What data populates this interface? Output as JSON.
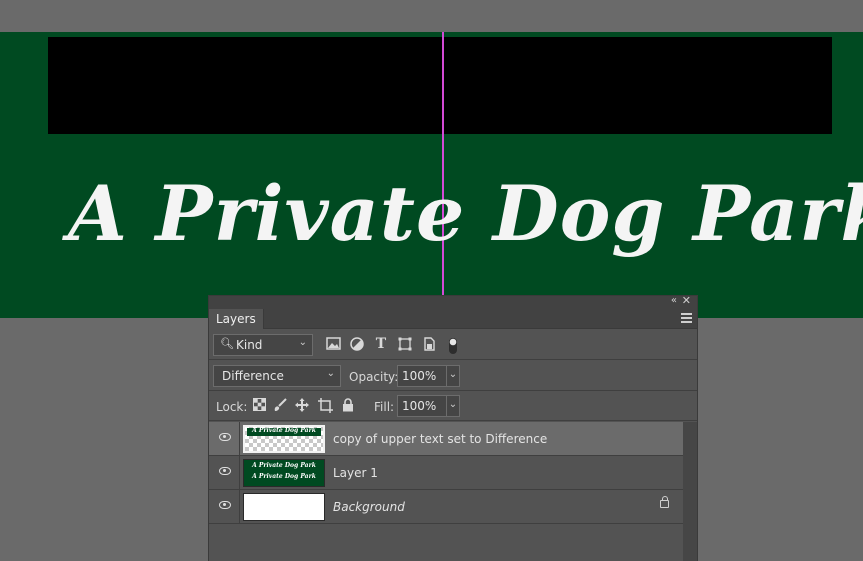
{
  "canvas": {
    "text": "A Private Dog Park",
    "background_color": "#004a21",
    "guide_color": "#d34ad6"
  },
  "panel": {
    "tab_label": "Layers",
    "filter": {
      "kind_label": "Kind",
      "icons": [
        "image-filter-icon",
        "adjustment-filter-icon",
        "type-filter-icon",
        "shape-filter-icon",
        "smart-object-filter-icon",
        "filter-toggle-icon"
      ]
    },
    "blend": {
      "mode": "Difference",
      "opacity_label": "Opacity:",
      "opacity_value": "100%"
    },
    "lock": {
      "label": "Lock:",
      "fill_label": "Fill:",
      "fill_value": "100%",
      "icons": [
        "lock-transparent-icon",
        "lock-paint-icon",
        "lock-position-icon",
        "lock-artboard-icon",
        "lock-all-icon"
      ]
    },
    "layers": [
      {
        "name": "copy of upper text set to Difference",
        "visible": true,
        "selected": true,
        "thumb_text": "A Private Dog Park"
      },
      {
        "name": "Layer 1",
        "visible": true,
        "selected": false,
        "thumb_text_top": "A Private Dog Park",
        "thumb_text_bottom": "A Private Dog Park"
      },
      {
        "name": "Background",
        "visible": true,
        "selected": false,
        "locked": true
      }
    ]
  }
}
